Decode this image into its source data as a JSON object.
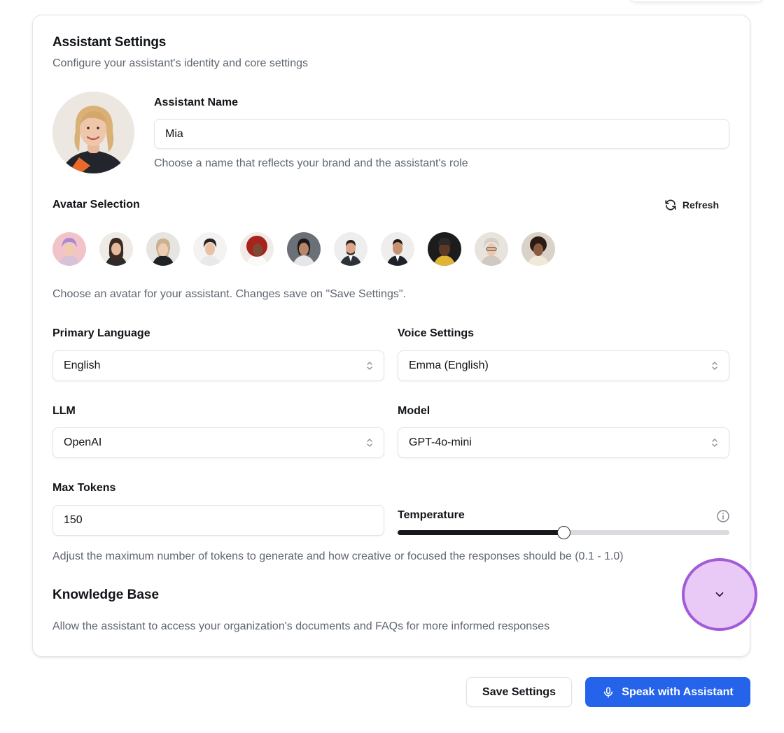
{
  "assistant_settings": {
    "title": "Assistant Settings",
    "subtitle": "Configure your assistant's identity and core settings"
  },
  "name_field": {
    "label": "Assistant Name",
    "value": "Mia",
    "hint": "Choose a name that reflects your brand and the assistant's role"
  },
  "avatar_selection": {
    "label": "Avatar Selection",
    "refresh_label": "Refresh",
    "hint": "Choose an avatar for your assistant. Changes save on \"Save Settings\".",
    "avatar_count": 11
  },
  "primary_language": {
    "label": "Primary Language",
    "value": "English"
  },
  "voice_settings": {
    "label": "Voice Settings",
    "value": "Emma (English)"
  },
  "llm": {
    "label": "LLM",
    "value": "OpenAI"
  },
  "model": {
    "label": "Model",
    "value": "GPT-4o-mini"
  },
  "max_tokens": {
    "label": "Max Tokens",
    "value": "150"
  },
  "temperature": {
    "label": "Temperature",
    "value_fraction": 0.5
  },
  "tokens_hint": "Adjust the maximum number of tokens to generate and how creative or focused the responses should be (0.1 - 1.0)",
  "knowledge_base": {
    "title": "Knowledge Base",
    "description": "Allow the assistant to access your organization's documents and FAQs for more informed responses"
  },
  "actions": {
    "save_label": "Save Settings",
    "speak_label": "Speak with Assistant"
  },
  "colors": {
    "primary_button": "#2563eb",
    "expand_highlight_fill": "#e9c9f5",
    "expand_highlight_ring": "#a25ad8"
  },
  "icons": {
    "refresh": "refresh-icon",
    "select": "chevron-up-down-icon",
    "info": "info-icon",
    "expand": "chevron-down-icon",
    "mic": "microphone-icon"
  }
}
